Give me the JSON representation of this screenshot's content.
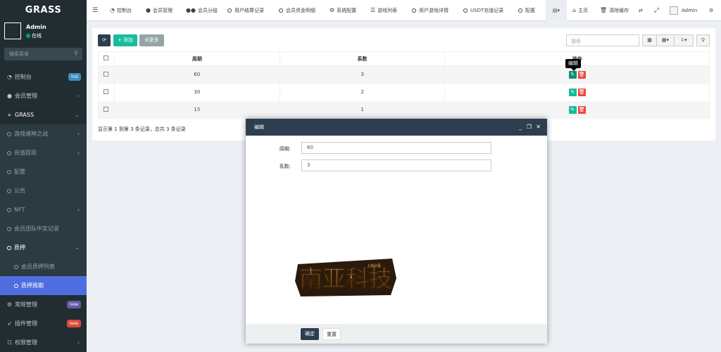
{
  "sidebar": {
    "logo": "GRASS",
    "user": {
      "name": "Admin",
      "status": "在线"
    },
    "search_placeholder": "搜索菜单",
    "items": [
      {
        "label": "控制台",
        "icon": "dashboard-icon",
        "badge": "hot"
      },
      {
        "label": "会员管理",
        "icon": "user-circle-icon",
        "arrow": "‹"
      },
      {
        "label": "GRASS",
        "icon": "chevron-right-double-icon",
        "arrow": "⌄"
      },
      {
        "label": "游戏诸神之战",
        "icon": "circle-icon",
        "arrow": "‹"
      },
      {
        "label": "充值提现",
        "icon": "circle-icon",
        "arrow": "‹"
      },
      {
        "label": "配置",
        "icon": "circle-icon"
      },
      {
        "label": "公告",
        "icon": "circle-icon"
      },
      {
        "label": "NFT",
        "icon": "circle-icon",
        "arrow": "‹"
      },
      {
        "label": "会员团队中奖记录",
        "icon": "circle-icon"
      },
      {
        "label": "质押",
        "icon": "circle-icon",
        "arrow": "⌄"
      },
      {
        "label": "会员质押列表",
        "icon": "circle-icon"
      },
      {
        "label": "质押周期",
        "icon": "circle-icon"
      },
      {
        "label": "常规管理",
        "icon": "cogs-icon",
        "badge": "new"
      },
      {
        "label": "插件管理",
        "icon": "rocket-icon",
        "badge": "new"
      },
      {
        "label": "权限管理",
        "icon": "group-icon",
        "arrow": "‹"
      }
    ]
  },
  "topbar": {
    "tabs": [
      {
        "label": "控制台",
        "icon": "dashboard-icon"
      },
      {
        "label": "会员管理",
        "icon": "user-icon"
      },
      {
        "label": "会员分组",
        "icon": "users-icon"
      },
      {
        "label": "用户结算记录",
        "icon": "circle-icon"
      },
      {
        "label": "会员资金明细",
        "icon": "circle-icon"
      },
      {
        "label": "系统配置",
        "icon": "gear-icon"
      },
      {
        "label": "游戏列表",
        "icon": "list-icon"
      },
      {
        "label": "用户游戏详情",
        "icon": "circle-icon"
      },
      {
        "label": "USDT充值记录",
        "icon": "circle-icon"
      },
      {
        "label": "配置",
        "icon": "circle-icon"
      }
    ],
    "right": {
      "home": "主页",
      "clear_cache": "清除缓存",
      "admin": "Admin"
    }
  },
  "toolbar": {
    "add_label": "添加",
    "more_label": "更多",
    "search_placeholder": "搜索"
  },
  "table": {
    "headers": [
      "周期",
      "系数",
      "操作"
    ],
    "rows": [
      {
        "period": "60",
        "coef": "3"
      },
      {
        "period": "30",
        "coef": "2"
      },
      {
        "period": "15",
        "coef": "1"
      }
    ],
    "tooltip": "编辑",
    "summary": "显示第 1 到第 3 条记录，总共 3 条记录"
  },
  "modal": {
    "title": "编辑",
    "fields": [
      {
        "label": "周期:",
        "value": "60"
      },
      {
        "label": "系数:",
        "value": "3"
      }
    ],
    "ok_label": "确定",
    "reset_label": "重置",
    "logo_text": "南亚科技",
    "logo_small_text": "上线必看"
  },
  "colors": {
    "sidebar_bg": "#222d32",
    "active_menu": "#4e6ee0",
    "primary": "#2c3e50",
    "success": "#18bc9c",
    "danger": "#e74c3c"
  }
}
